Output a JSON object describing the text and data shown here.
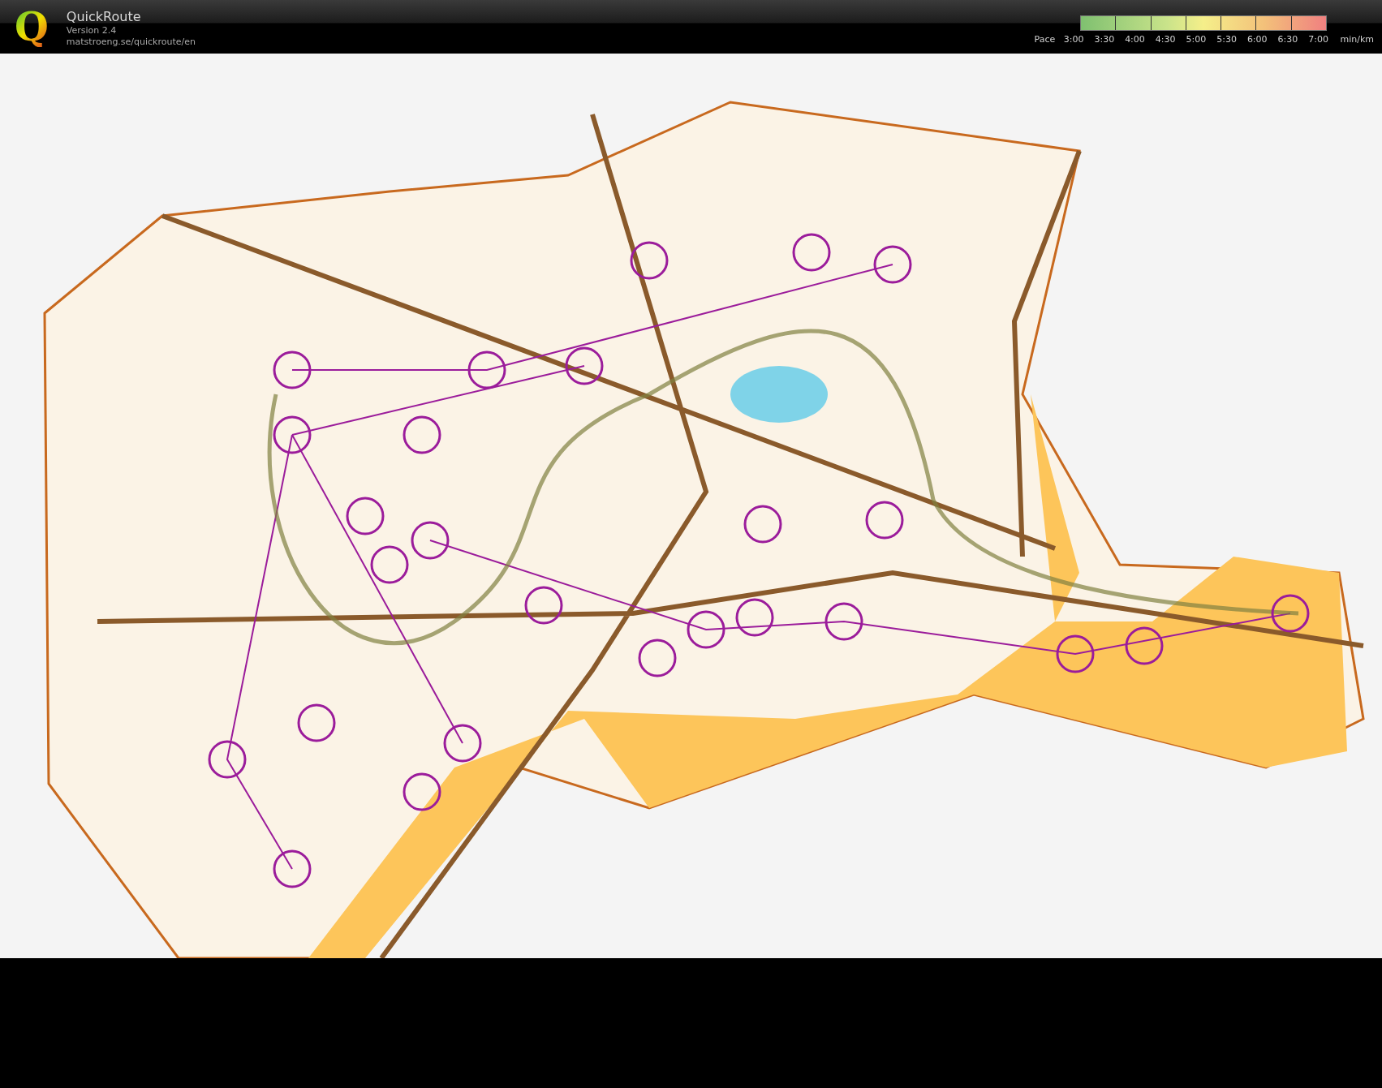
{
  "app": {
    "logo": "Q",
    "name": "QuickRoute",
    "version": "Version 2.4",
    "url": "matstroeng.se/quickroute/en"
  },
  "pace_legend": {
    "label": "Pace",
    "unit": "min/km",
    "ticks": [
      "3:00",
      "3:30",
      "4:00",
      "4:30",
      "5:00",
      "5:30",
      "6:00",
      "6:30",
      "7:00"
    ]
  }
}
